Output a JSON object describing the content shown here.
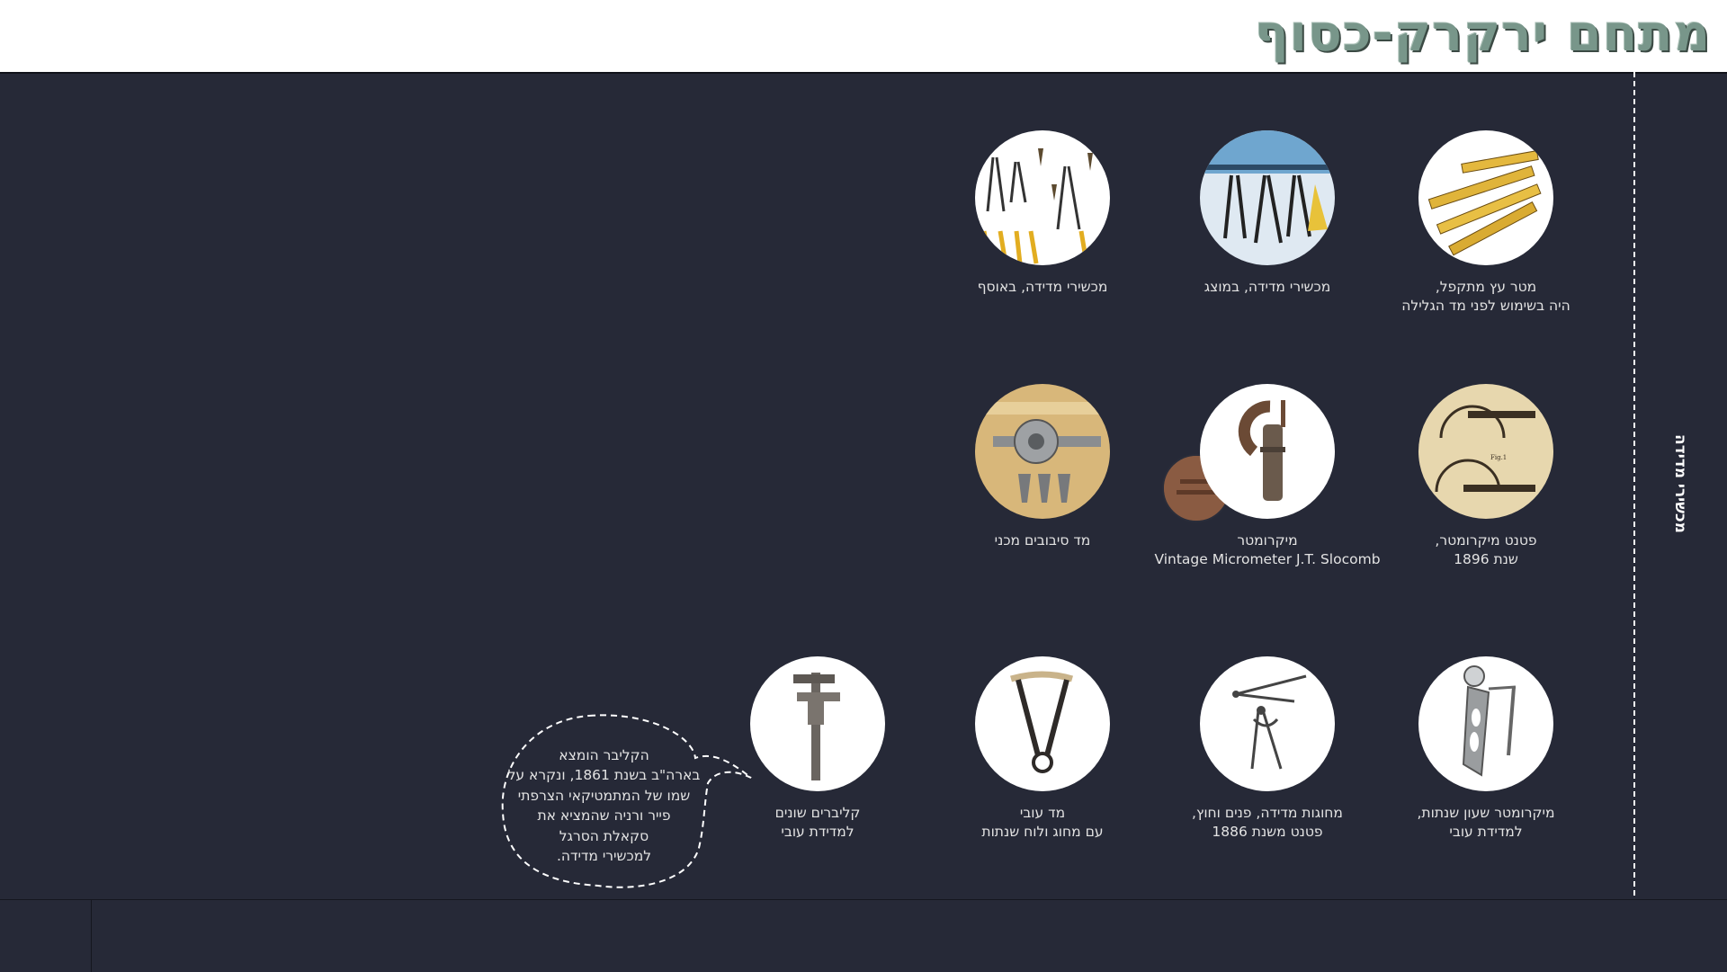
{
  "page": {
    "title": "מתחם ירקרק-כסוף"
  },
  "side_label": "מכשירי מדידה",
  "items": [
    {
      "icon": "folding-ruler-icon",
      "caption": [
        "מטר עץ מתקפל,",
        "היה בשימוש לפני מד הגלילה"
      ]
    },
    {
      "icon": "display-tools-icon",
      "caption": [
        "מכשירי מדידה, במוצג"
      ]
    },
    {
      "icon": "collection-tools-icon",
      "caption": [
        "מכשירי מדידה, באוסף"
      ]
    },
    {
      "icon": "micrometer-patent-icon",
      "caption": [
        "פטנט מיקרומטר,",
        "שנת 1896"
      ]
    },
    {
      "icon": "micrometer-icon",
      "caption": [
        "מיקרומטר",
        "Vintage Micrometer J.T. Slocomb"
      ]
    },
    {
      "icon": "thread-gauge-icon",
      "caption": [
        "מד סיבובים מכני"
      ]
    },
    {
      "icon": "dial-micrometer-icon",
      "caption": [
        "מיקרומטר שעון שנתות,",
        "למדידת עובי"
      ]
    },
    {
      "icon": "calipers-icon",
      "caption": [
        "מחוגות מדידה, פנים וחוץ,",
        "פטנט משנת 1886"
      ]
    },
    {
      "icon": "thickness-gauge-icon",
      "caption": [
        "מד עובי",
        "עם מחוג ולוח שנתות"
      ]
    },
    {
      "icon": "vernier-caliper-icon",
      "caption": [
        "קליברים שונים",
        "למדידת עובי"
      ]
    }
  ],
  "bubble": {
    "lines": [
      "הקליבר הומצא",
      "בארה\"ב בשנת 1861, ונקרא על",
      "שמו של המתמטיקאי הצרפתי",
      "פייר ורניה שהמציא את",
      "סקאלת הסרגל",
      "למכשירי מדידה."
    ]
  },
  "colors": {
    "background": "#262937",
    "title": "#78968a",
    "text": "#e3e3e3"
  }
}
